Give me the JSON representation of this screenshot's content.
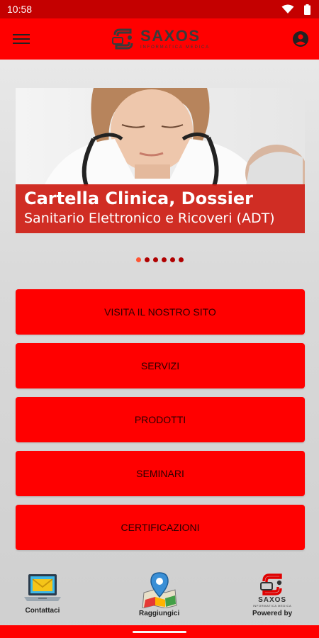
{
  "status_bar": {
    "time": "10:58"
  },
  "brand": {
    "name": "SAXOS",
    "tagline": "INFORMATICA MEDICA"
  },
  "banner": {
    "title": "Cartella Clinica, Dossier",
    "subtitle": "Sanitario Elettronico e Ricoveri (ADT)",
    "slide_count": 6,
    "active_slide": 1
  },
  "menu": {
    "items": [
      {
        "label": "VISITA IL NOSTRO SITO"
      },
      {
        "label": "SERVIZI"
      },
      {
        "label": "PRODOTTI"
      },
      {
        "label": "SEMINARI"
      },
      {
        "label": "CERTIFICAZIONI"
      }
    ]
  },
  "bottom_bar": {
    "contact": {
      "label": "Contattaci",
      "icon": "laptop-mail-icon"
    },
    "reach": {
      "label": "Raggiungici",
      "icon": "map-pin-icon"
    },
    "powered": {
      "label": "Powered by",
      "logo_text": "SAXOS",
      "logo_sub": "INFORMATICA MEDICA"
    }
  },
  "colors": {
    "primary": "#ff0000",
    "status": "#c40000",
    "caption": "#cd1e14"
  }
}
